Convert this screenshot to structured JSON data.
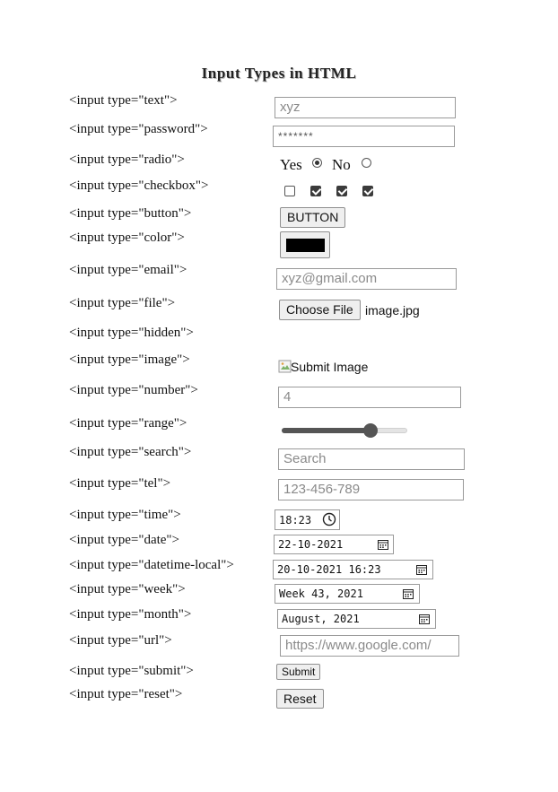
{
  "title": "Input Types in HTML",
  "rows": [
    {
      "label": "<input type=\"text\">"
    },
    {
      "label": "<input type=\"password\">"
    },
    {
      "label": "<input type=\"radio\">"
    },
    {
      "label": "<input type=\"checkbox\">"
    },
    {
      "label": "<input type=\"button\">"
    },
    {
      "label": "<input type=\"color\">"
    },
    {
      "label": "<input type=\"email\">"
    },
    {
      "label": "<input type=\"file\">"
    },
    {
      "label": "<input type=\"hidden\">"
    },
    {
      "label": "<input type=\"image\">"
    },
    {
      "label": "<input type=\"number\">"
    },
    {
      "label": "<input type=\"range\">"
    },
    {
      "label": "<input type=\"search\">"
    },
    {
      "label": "<input type=\"tel\">"
    },
    {
      "label": "<input type=\"time\">"
    },
    {
      "label": "<input type=\"date\">"
    },
    {
      "label": "<input type=\"datetime-local\">"
    },
    {
      "label": "<input type=\"week\">"
    },
    {
      "label": "<input type=\"month\">"
    },
    {
      "label": "<input type=\"url\">"
    },
    {
      "label": "<input type=\"submit\">"
    },
    {
      "label": "<input type=\"reset\">"
    }
  ],
  "controls": {
    "text_value": "xyz",
    "password_value": "*******",
    "radio_yes": "Yes",
    "radio_no": "No",
    "radio_yes_checked": true,
    "checkboxes_checked": [
      false,
      true,
      true,
      true
    ],
    "button_label": "BUTTON",
    "color_value": "#000000",
    "email_value": "xyz@gmail.com",
    "file_button": "Choose File",
    "file_name": "image.jpg",
    "image_alt": "Submit Image",
    "number_value": "4",
    "range_fraction": 0.73,
    "search_placeholder": "Search",
    "tel_placeholder": "123-456-789",
    "time_value": "18:23",
    "date_value": "22-10-2021",
    "datetime_value": "20-10-2021 16:23",
    "week_value": "Week 43, 2021",
    "month_value": "August, 2021",
    "url_placeholder": "https://www.google.com/",
    "submit_label": "Submit",
    "reset_label": "Reset"
  }
}
